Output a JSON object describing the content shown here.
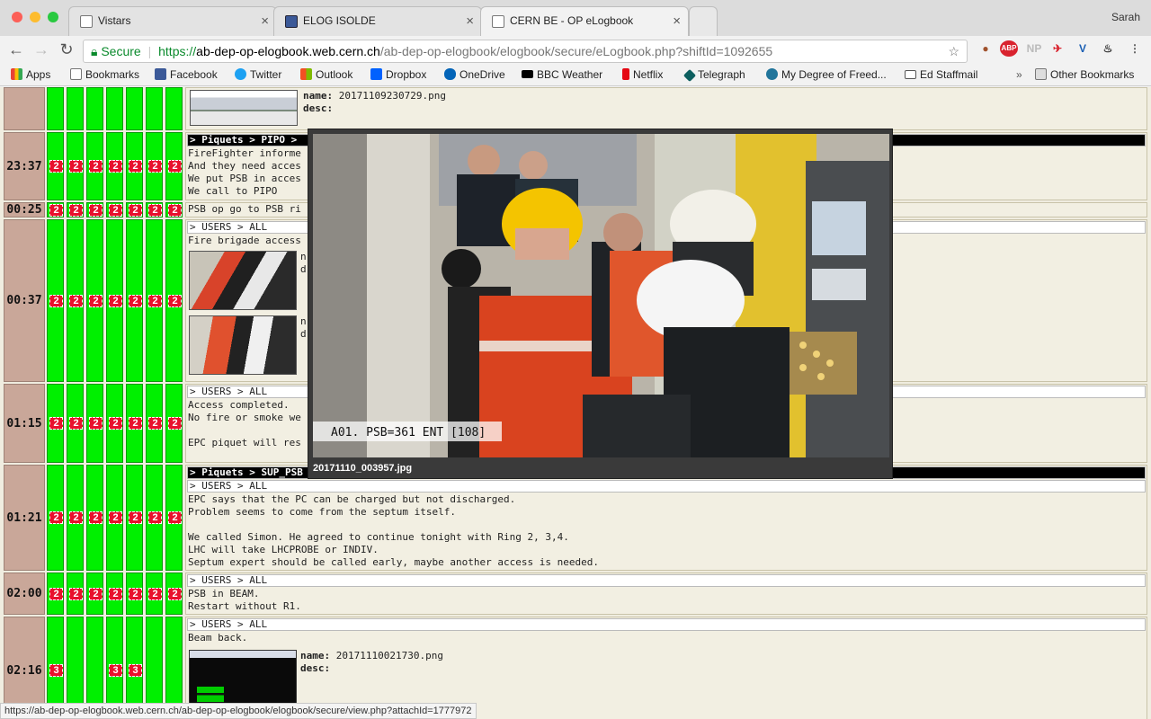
{
  "window": {
    "profile_name": "Sarah"
  },
  "tabs": [
    {
      "label": "Vistars",
      "active": false
    },
    {
      "label": "ELOG ISOLDE",
      "active": false
    },
    {
      "label": "CERN BE - OP eLogbook",
      "active": true
    }
  ],
  "toolbar": {
    "secure_label": "Secure",
    "url_scheme": "https://",
    "url_host": "ab-dep-op-elogbook.web.cern.ch",
    "url_path": "/ab-dep-op-elogbook/elogbook/secure/eLogbook.php?shiftId=1092655",
    "extensions": [
      "ABP",
      "NP"
    ]
  },
  "bookmarks": {
    "items": [
      "Apps",
      "Bookmarks",
      "Facebook",
      "Twitter",
      "Outlook",
      "Dropbox",
      "OneDrive",
      "BBC Weather",
      "Netflix",
      "Telegraph",
      "My Degree of Freed...",
      "Ed Staffmail"
    ],
    "overflow": "»",
    "other": "Other Bookmarks"
  },
  "logbook": {
    "rows": [
      {
        "time": "",
        "badges": "",
        "name_label": "name:",
        "name_value": "20171109230729.png",
        "desc_label": "desc:"
      },
      {
        "time": "23:37",
        "badges": "2",
        "header": "> Piquets > PIPO >",
        "lines": [
          "FireFighter informe",
          "And they need acces",
          "We put PSB in acces",
          "We call to PIPO"
        ]
      },
      {
        "time": "00:25",
        "badges": "2",
        "lines": [
          "PSB op go to PSB ri"
        ]
      },
      {
        "time": "00:37",
        "badges": "2",
        "header": "> USERS > ALL",
        "lines": [
          "Fire brigade access"
        ],
        "meta_a": "n",
        "meta_b": "d"
      },
      {
        "time": "01:15",
        "badges": "2",
        "header": "> USERS > ALL",
        "lines": [
          "Access completed.",
          "No fire or smoke we",
          "",
          "EPC piquet will res"
        ]
      },
      {
        "time": "01:21",
        "badges": "2",
        "header": "> Piquets > SUP_PSB",
        "subheader": "> USERS > ALL",
        "lines": [
          "EPC says that the PC can be charged but not discharged.",
          "Problem seems to come from the septum itself.",
          "",
          "We called Simon. He agreed to continue tonight with Ring 2, 3,4.",
          "LHC will take LHCPROBE or INDIV.",
          "Septum expert should be called early, maybe another access is needed."
        ]
      },
      {
        "time": "02:00",
        "badges": "2",
        "header": "> USERS > ALL",
        "lines": [
          "PSB in BEAM.",
          "Restart without R1."
        ]
      },
      {
        "time": "02:16",
        "badges": "3",
        "header": "> USERS > ALL",
        "lines": [
          "Beam back."
        ],
        "name_label": "name:",
        "name_value": "20171110021730.png",
        "desc_label": "desc:"
      }
    ]
  },
  "popup": {
    "caption": "20171110_003957.jpg",
    "overlay_text": "A01. PSB=361 ENT [108]"
  },
  "status_bar": {
    "text": "https://ab-dep-op-elogbook.web.cern.ch/ab-dep-op-elogbook/elogbook/secure/view.php?attachId=1777972"
  }
}
